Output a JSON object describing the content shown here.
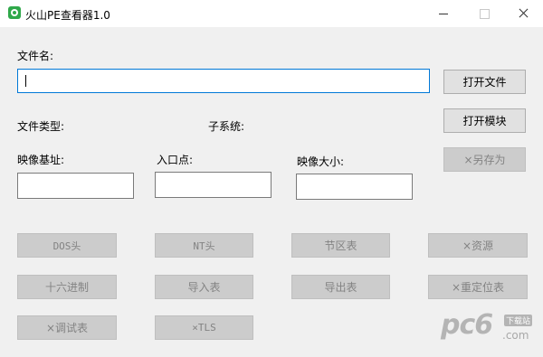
{
  "window": {
    "title": "火山PE查看器1.0",
    "icon": "volcano-app-icon"
  },
  "form": {
    "filename_label": "文件名:",
    "filename_value": "",
    "filetype_label": "文件类型:",
    "subsystem_label": "子系统:",
    "imagebase_label": "映像基址:",
    "entrypoint_label": "入口点:",
    "imagesize_label": "映像大小:",
    "imagebase_value": "",
    "entrypoint_value": "",
    "imagesize_value": ""
  },
  "side_buttons": {
    "open_file": "打开文件",
    "open_module": "打开模块",
    "save_as": "×另存为"
  },
  "section_buttons": [
    "DOS头",
    "NT头",
    "节区表",
    "×资源",
    "十六进制",
    "导入表",
    "导出表",
    "×重定位表",
    "×调试表",
    "×TLS"
  ],
  "watermark": {
    "main": "pc6",
    "badge": "下载站",
    "sub": ".com"
  },
  "colors": {
    "focus_border": "#0078d7",
    "disabled_text": "#838383"
  }
}
